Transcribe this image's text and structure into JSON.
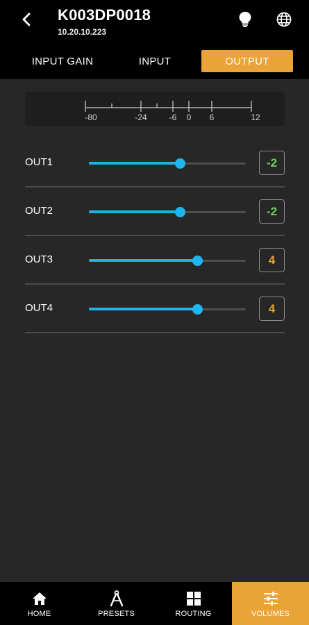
{
  "header": {
    "device_name": "K003DP0018",
    "device_ip": "10.20.10.223",
    "icons": [
      "back-arrow-icon",
      "lightbulb-icon",
      "globe-icon"
    ]
  },
  "tabs": [
    {
      "label": "INPUT GAIN",
      "active": false
    },
    {
      "label": "INPUT",
      "active": false
    },
    {
      "label": "OUTPUT",
      "active": true
    }
  ],
  "scale": {
    "ticks": [
      "-80",
      "-24",
      "-6",
      "0",
      "6",
      "12"
    ]
  },
  "outputs": [
    {
      "label": "OUT1",
      "value": "-2",
      "value_color": "#6fcf5a",
      "level_fraction": 0.58
    },
    {
      "label": "OUT2",
      "value": "-2",
      "value_color": "#6fcf5a",
      "level_fraction": 0.58
    },
    {
      "label": "OUT3",
      "value": "4",
      "value_color": "#eaa338",
      "level_fraction": 0.69
    },
    {
      "label": "OUT4",
      "value": "4",
      "value_color": "#eaa338",
      "level_fraction": 0.69
    }
  ],
  "nav": [
    {
      "label": "HOME",
      "icon": "home-icon",
      "active": false
    },
    {
      "label": "PRESETS",
      "icon": "presets-icon",
      "active": false
    },
    {
      "label": "ROUTING",
      "icon": "routing-grid-icon",
      "active": false
    },
    {
      "label": "VOLUMES",
      "icon": "volumes-sliders-icon",
      "active": true
    }
  ],
  "colors": {
    "accent": "#eaa338",
    "slider": "#1fb2ea",
    "background": "#272727",
    "header": "#000000"
  }
}
